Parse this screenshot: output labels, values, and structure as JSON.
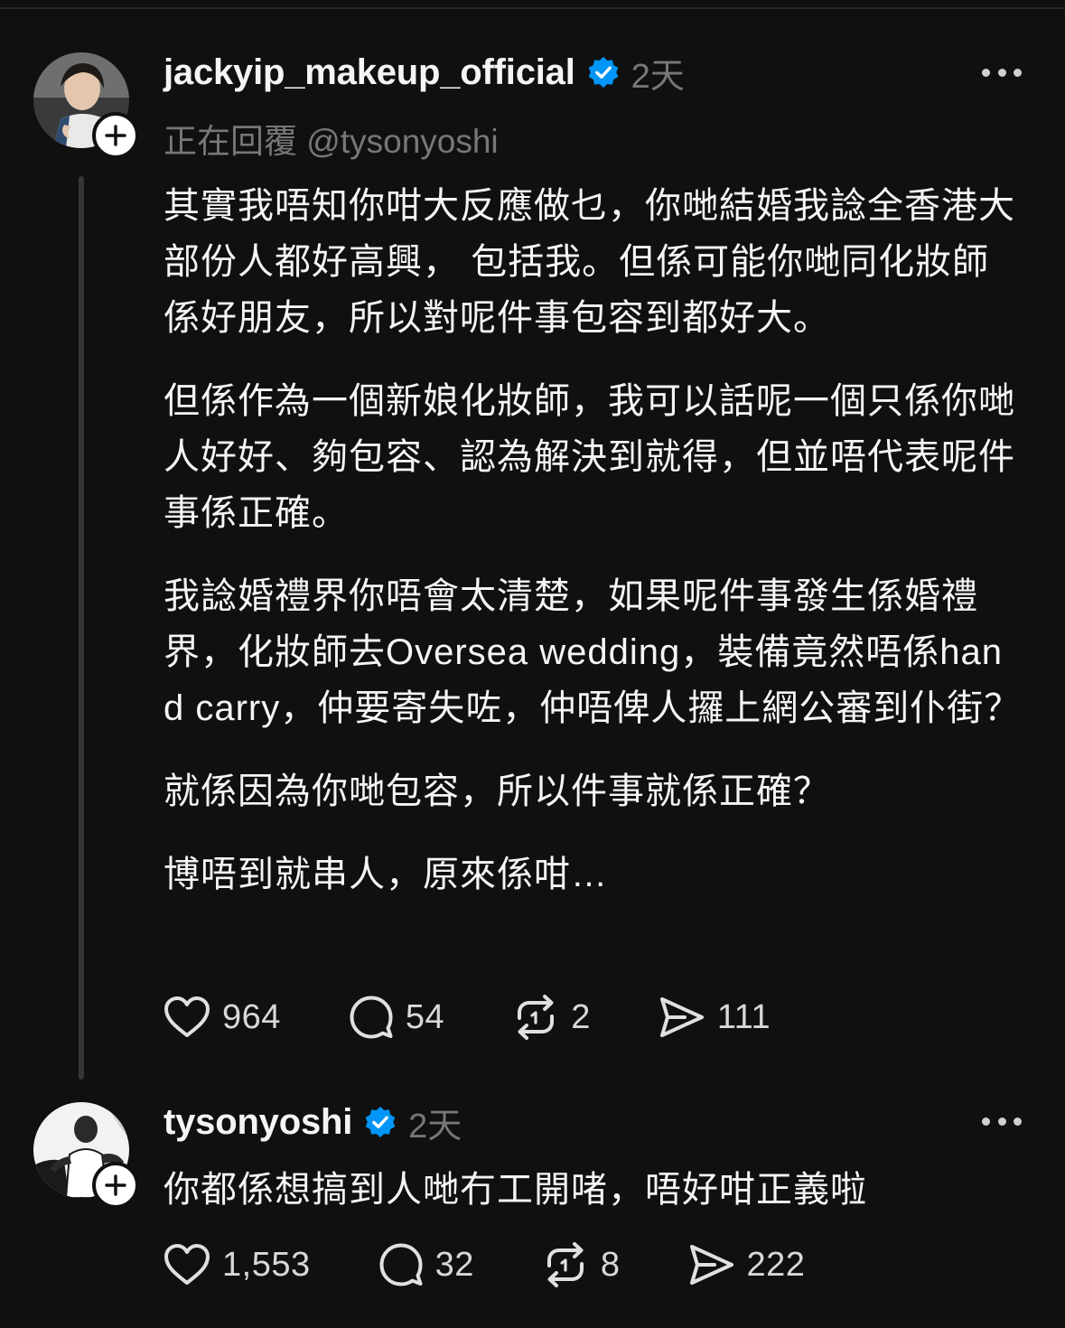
{
  "post1": {
    "username": "jackyip_makeup_official",
    "time": "2天",
    "replying_to": "正在回覆 @tysonyoshi",
    "paragraphs": [
      "其實我唔知你咁大反應做乜，你哋結婚我諗全香港大部份人都好高興， 包括我。但係可能你哋同化妝師係好朋友，所以對呢件事包容到都好大。",
      "但係作為一個新娘化妝師，我可以話呢一個只係你哋人好好、夠包容、認為解決到就得，但並唔代表呢件事係正確。",
      "我諗婚禮界你唔會太清楚，如果呢件事發生係婚禮界，化妝師去Oversea wedding，裝備竟然唔係hand carry，仲要寄失咗，仲唔俾人攞上網公審到仆街？",
      "就係因為你哋包容，所以件事就係正確？",
      "博唔到就串人，原來係咁…"
    ],
    "likes": "964",
    "comments": "54",
    "reposts": "2",
    "shares": "111"
  },
  "post2": {
    "username": "tysonyoshi",
    "time": "2天",
    "text": "你都係想搞到人哋冇工開啫，唔好咁正義啦",
    "likes": "1,553",
    "comments": "32",
    "reposts": "8",
    "shares": "222"
  },
  "icons": {
    "verified": "verified-badge-icon",
    "follow": "plus-icon",
    "more": "more-horizontal-icon",
    "like": "heart-icon",
    "comment": "comment-icon",
    "repost": "repost-icon",
    "share": "send-icon"
  },
  "colors": {
    "background": "#101010",
    "text": "#f3f5f7",
    "muted": "#777777",
    "verified": "#0095f6"
  }
}
